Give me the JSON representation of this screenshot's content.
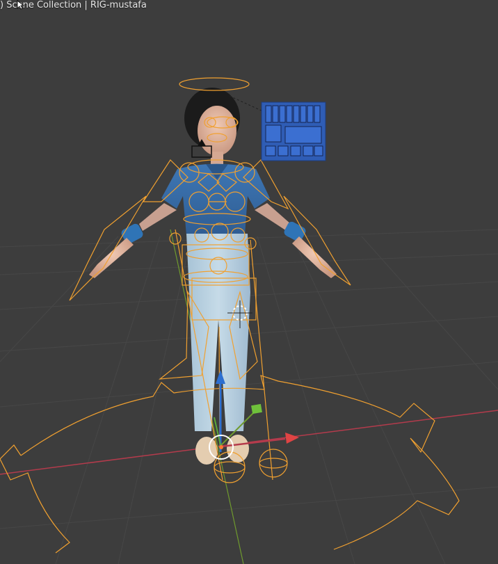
{
  "viewport": {
    "header_text": ") Scene Collection | RIG-mustafa",
    "background_color": "#3d3d3d",
    "grid_color": "#4a4a4a",
    "x_axis_color": "#b43b4c",
    "y_axis_color": "#6f9a2e",
    "rig_color": "#f0a030"
  },
  "icons": {
    "cursor": "mouse-pointer-icon",
    "gizmo_z": "gizmo-z-arrow-icon",
    "gizmo_x": "gizmo-x-arrow-icon",
    "gizmo_y": "gizmo-y-handle-icon",
    "camera": "camera-icon",
    "cursor3d": "3d-cursor-icon"
  }
}
